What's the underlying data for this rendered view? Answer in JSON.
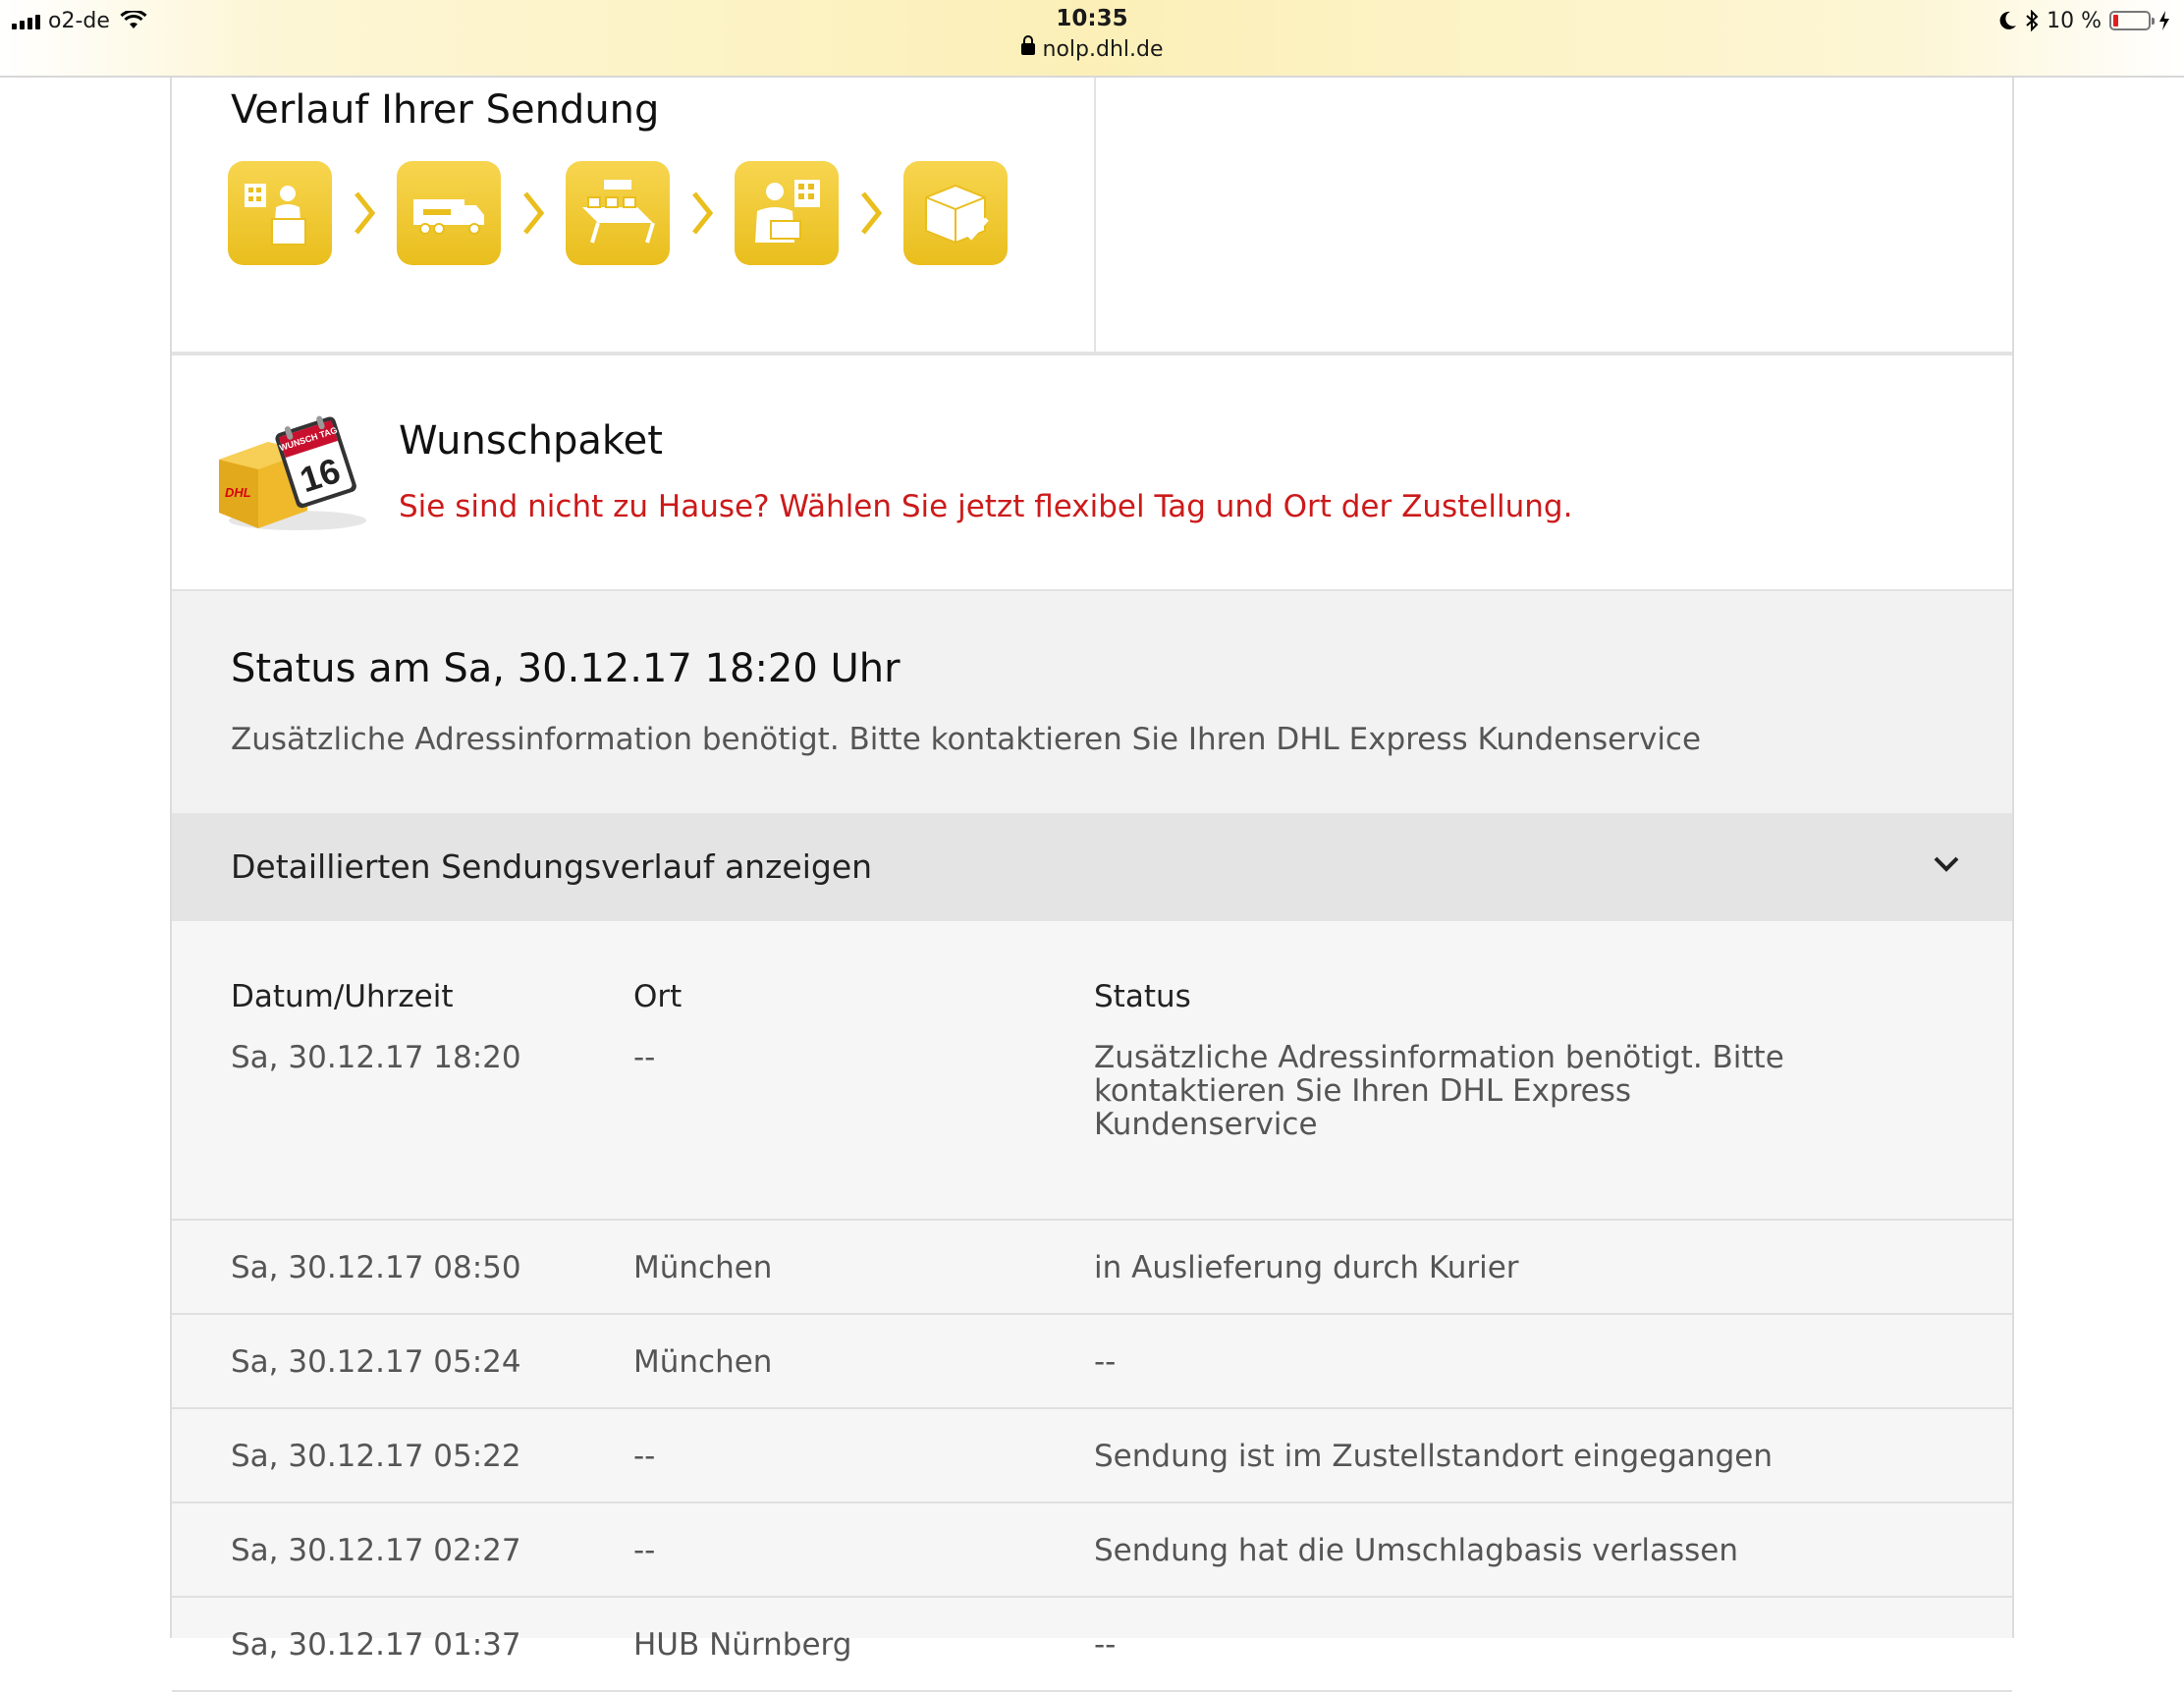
{
  "status_bar": {
    "carrier": "o2-de",
    "time": "10:35",
    "url": "nolp.dhl.de",
    "battery": "10 %",
    "battery_level": 0.1
  },
  "verlauf": {
    "title": "Verlauf Ihrer Sendung",
    "steps": [
      "pickup-icon",
      "truck-icon",
      "sorting-conveyor-icon",
      "courier-delivery-icon",
      "delivered-parcel-icon"
    ]
  },
  "wunschpaket": {
    "title": "Wunschpaket",
    "link": "Sie sind nicht zu Hause? Wählen Sie jetzt flexibel Tag und Ort der Zustellung.",
    "icon_badge": "WUNSCH TAG",
    "icon_day": "16",
    "icon_brand": "DHL"
  },
  "status": {
    "title": "Status am Sa, 30.12.17 18:20 Uhr",
    "text": "Zusätzliche Adressinformation benötigt. Bitte kontaktieren Sie Ihren DHL Express Kundenservice"
  },
  "details_toggle": {
    "label": "Detaillierten Sendungsverlauf anzeigen"
  },
  "history": {
    "headers": [
      "Datum/Uhrzeit",
      "Ort",
      "Status"
    ],
    "rows": [
      [
        "Sa, 30.12.17 18:20",
        "--",
        "Zusätzliche Adressinformation benötigt. Bitte kontaktieren Sie Ihren DHL Express Kundenservice"
      ],
      [
        "Sa, 30.12.17 08:50",
        "München",
        "in Auslieferung durch Kurier"
      ],
      [
        "Sa, 30.12.17 05:24",
        "München",
        "--"
      ],
      [
        "Sa, 30.12.17 05:22",
        "--",
        "Sendung ist im Zustellstandort eingegangen"
      ],
      [
        "Sa, 30.12.17 02:27",
        "--",
        "Sendung hat die Umschlagbasis verlassen"
      ],
      [
        "Sa, 30.12.17 01:37",
        "HUB Nürnberg",
        "--"
      ]
    ]
  },
  "colors": {
    "dhl_yellow": "#f2c82f",
    "link_red": "#cc1a1a",
    "status_bg": "#f2f2f2",
    "toggle_bg": "#e4e4e4"
  }
}
